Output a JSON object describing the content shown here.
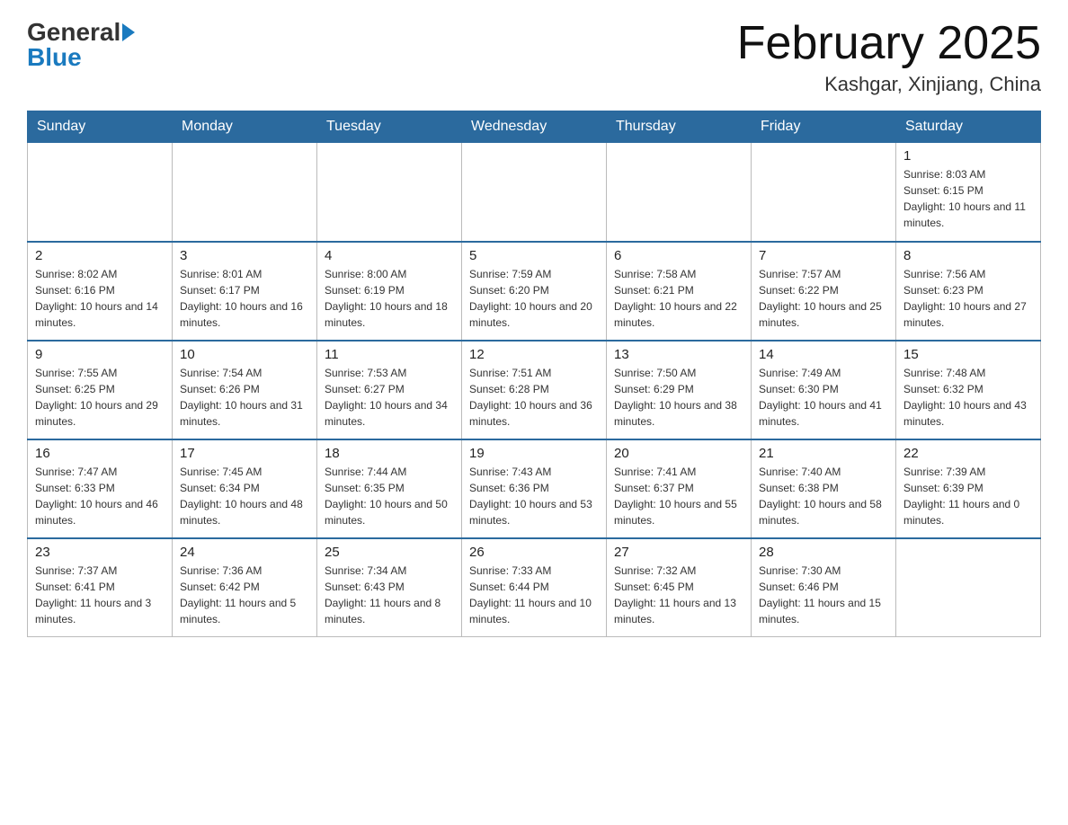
{
  "header": {
    "logo_general": "General",
    "logo_blue": "Blue",
    "month_title": "February 2025",
    "subtitle": "Kashgar, Xinjiang, China"
  },
  "weekdays": [
    "Sunday",
    "Monday",
    "Tuesday",
    "Wednesday",
    "Thursday",
    "Friday",
    "Saturday"
  ],
  "weeks": [
    [
      {
        "day": "",
        "sunrise": "",
        "sunset": "",
        "daylight": ""
      },
      {
        "day": "",
        "sunrise": "",
        "sunset": "",
        "daylight": ""
      },
      {
        "day": "",
        "sunrise": "",
        "sunset": "",
        "daylight": ""
      },
      {
        "day": "",
        "sunrise": "",
        "sunset": "",
        "daylight": ""
      },
      {
        "day": "",
        "sunrise": "",
        "sunset": "",
        "daylight": ""
      },
      {
        "day": "",
        "sunrise": "",
        "sunset": "",
        "daylight": ""
      },
      {
        "day": "1",
        "sunrise": "Sunrise: 8:03 AM",
        "sunset": "Sunset: 6:15 PM",
        "daylight": "Daylight: 10 hours and 11 minutes."
      }
    ],
    [
      {
        "day": "2",
        "sunrise": "Sunrise: 8:02 AM",
        "sunset": "Sunset: 6:16 PM",
        "daylight": "Daylight: 10 hours and 14 minutes."
      },
      {
        "day": "3",
        "sunrise": "Sunrise: 8:01 AM",
        "sunset": "Sunset: 6:17 PM",
        "daylight": "Daylight: 10 hours and 16 minutes."
      },
      {
        "day": "4",
        "sunrise": "Sunrise: 8:00 AM",
        "sunset": "Sunset: 6:19 PM",
        "daylight": "Daylight: 10 hours and 18 minutes."
      },
      {
        "day": "5",
        "sunrise": "Sunrise: 7:59 AM",
        "sunset": "Sunset: 6:20 PM",
        "daylight": "Daylight: 10 hours and 20 minutes."
      },
      {
        "day": "6",
        "sunrise": "Sunrise: 7:58 AM",
        "sunset": "Sunset: 6:21 PM",
        "daylight": "Daylight: 10 hours and 22 minutes."
      },
      {
        "day": "7",
        "sunrise": "Sunrise: 7:57 AM",
        "sunset": "Sunset: 6:22 PM",
        "daylight": "Daylight: 10 hours and 25 minutes."
      },
      {
        "day": "8",
        "sunrise": "Sunrise: 7:56 AM",
        "sunset": "Sunset: 6:23 PM",
        "daylight": "Daylight: 10 hours and 27 minutes."
      }
    ],
    [
      {
        "day": "9",
        "sunrise": "Sunrise: 7:55 AM",
        "sunset": "Sunset: 6:25 PM",
        "daylight": "Daylight: 10 hours and 29 minutes."
      },
      {
        "day": "10",
        "sunrise": "Sunrise: 7:54 AM",
        "sunset": "Sunset: 6:26 PM",
        "daylight": "Daylight: 10 hours and 31 minutes."
      },
      {
        "day": "11",
        "sunrise": "Sunrise: 7:53 AM",
        "sunset": "Sunset: 6:27 PM",
        "daylight": "Daylight: 10 hours and 34 minutes."
      },
      {
        "day": "12",
        "sunrise": "Sunrise: 7:51 AM",
        "sunset": "Sunset: 6:28 PM",
        "daylight": "Daylight: 10 hours and 36 minutes."
      },
      {
        "day": "13",
        "sunrise": "Sunrise: 7:50 AM",
        "sunset": "Sunset: 6:29 PM",
        "daylight": "Daylight: 10 hours and 38 minutes."
      },
      {
        "day": "14",
        "sunrise": "Sunrise: 7:49 AM",
        "sunset": "Sunset: 6:30 PM",
        "daylight": "Daylight: 10 hours and 41 minutes."
      },
      {
        "day": "15",
        "sunrise": "Sunrise: 7:48 AM",
        "sunset": "Sunset: 6:32 PM",
        "daylight": "Daylight: 10 hours and 43 minutes."
      }
    ],
    [
      {
        "day": "16",
        "sunrise": "Sunrise: 7:47 AM",
        "sunset": "Sunset: 6:33 PM",
        "daylight": "Daylight: 10 hours and 46 minutes."
      },
      {
        "day": "17",
        "sunrise": "Sunrise: 7:45 AM",
        "sunset": "Sunset: 6:34 PM",
        "daylight": "Daylight: 10 hours and 48 minutes."
      },
      {
        "day": "18",
        "sunrise": "Sunrise: 7:44 AM",
        "sunset": "Sunset: 6:35 PM",
        "daylight": "Daylight: 10 hours and 50 minutes."
      },
      {
        "day": "19",
        "sunrise": "Sunrise: 7:43 AM",
        "sunset": "Sunset: 6:36 PM",
        "daylight": "Daylight: 10 hours and 53 minutes."
      },
      {
        "day": "20",
        "sunrise": "Sunrise: 7:41 AM",
        "sunset": "Sunset: 6:37 PM",
        "daylight": "Daylight: 10 hours and 55 minutes."
      },
      {
        "day": "21",
        "sunrise": "Sunrise: 7:40 AM",
        "sunset": "Sunset: 6:38 PM",
        "daylight": "Daylight: 10 hours and 58 minutes."
      },
      {
        "day": "22",
        "sunrise": "Sunrise: 7:39 AM",
        "sunset": "Sunset: 6:39 PM",
        "daylight": "Daylight: 11 hours and 0 minutes."
      }
    ],
    [
      {
        "day": "23",
        "sunrise": "Sunrise: 7:37 AM",
        "sunset": "Sunset: 6:41 PM",
        "daylight": "Daylight: 11 hours and 3 minutes."
      },
      {
        "day": "24",
        "sunrise": "Sunrise: 7:36 AM",
        "sunset": "Sunset: 6:42 PM",
        "daylight": "Daylight: 11 hours and 5 minutes."
      },
      {
        "day": "25",
        "sunrise": "Sunrise: 7:34 AM",
        "sunset": "Sunset: 6:43 PM",
        "daylight": "Daylight: 11 hours and 8 minutes."
      },
      {
        "day": "26",
        "sunrise": "Sunrise: 7:33 AM",
        "sunset": "Sunset: 6:44 PM",
        "daylight": "Daylight: 11 hours and 10 minutes."
      },
      {
        "day": "27",
        "sunrise": "Sunrise: 7:32 AM",
        "sunset": "Sunset: 6:45 PM",
        "daylight": "Daylight: 11 hours and 13 minutes."
      },
      {
        "day": "28",
        "sunrise": "Sunrise: 7:30 AM",
        "sunset": "Sunset: 6:46 PM",
        "daylight": "Daylight: 11 hours and 15 minutes."
      },
      {
        "day": "",
        "sunrise": "",
        "sunset": "",
        "daylight": ""
      }
    ]
  ]
}
